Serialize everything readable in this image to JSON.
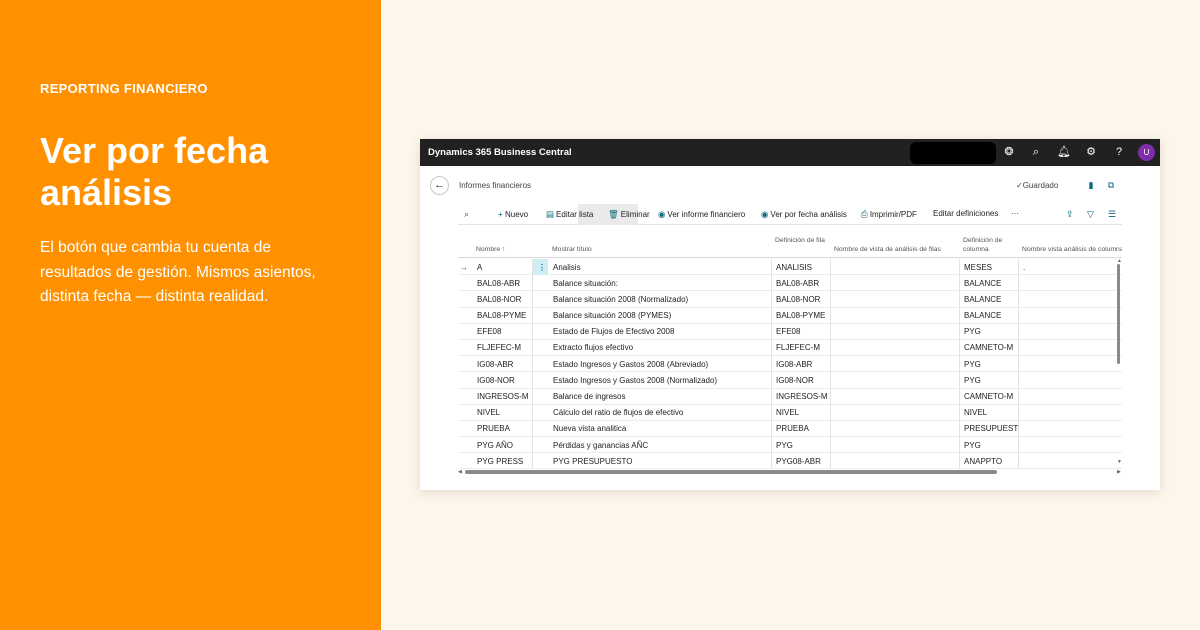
{
  "left_panel": {
    "eyebrow": "REPORTING FINANCIERO",
    "headline": "Ver por fecha análisis",
    "body": "El botón que cambia tu cuenta de resultados de gestión. Mismos asientos, distinta fecha — distinta realidad."
  },
  "app": {
    "title": "Dynamics 365 Business Central",
    "avatar_initial": "U",
    "topbar_icons": [
      "copilot-icon",
      "search-icon",
      "bell-icon",
      "gear-icon",
      "help-icon"
    ]
  },
  "page": {
    "breadcrumb": "Informes financieros",
    "saved_label": "Guardado"
  },
  "actions": {
    "nuevo": "Nuevo",
    "editar_lista": "Editar lista",
    "eliminar": "Eliminar",
    "ver_informe": "Ver informe financiero",
    "ver_fecha": "Ver por fecha análisis",
    "imprimir": "Imprimir/PDF",
    "editar_definiciones": "Editar definiciones",
    "more": "···"
  },
  "table": {
    "headers": {
      "nombre": "Nombre ↑",
      "titulo": "Mostrar título",
      "def_fila": "Definición de fila",
      "vista_filas": "Nombre de vista de análisis de filas",
      "def_columna": "Definición de columna",
      "vista_columnas": "Nombre vista análisis de columnas"
    },
    "rows": [
      {
        "nombre": "A",
        "titulo": "Analisis",
        "fila": "ANALISIS",
        "columna": "MESES",
        "vista_col": "."
      },
      {
        "nombre": "BAL08-ABR",
        "titulo": "Balance situación:",
        "fila": "BAL08-ABR",
        "columna": "BALANCE",
        "vista_col": ""
      },
      {
        "nombre": "BAL08-NOR",
        "titulo": "Balance situación 2008 (Normalizado)",
        "fila": "BAL08-NOR",
        "columna": "BALANCE",
        "vista_col": ""
      },
      {
        "nombre": "BAL08-PYME",
        "titulo": "Balance situación 2008 (PYMES)",
        "fila": "BAL08-PYME",
        "columna": "BALANCE",
        "vista_col": ""
      },
      {
        "nombre": "EFE08",
        "titulo": "Estado de Flujos de Efectivo 2008",
        "fila": "EFE08",
        "columna": "PYG",
        "vista_col": ""
      },
      {
        "nombre": "FLJEFEC-M",
        "titulo": "Extracto flujos efectivo",
        "fila": "FLJEFEC-M",
        "columna": "CAMNETO-M",
        "vista_col": ""
      },
      {
        "nombre": "IG08-ABR",
        "titulo": "Estado Ingresos y Gastos 2008 (Abreviado)",
        "fila": "IG08-ABR",
        "columna": "PYG",
        "vista_col": ""
      },
      {
        "nombre": "IG08-NOR",
        "titulo": "Estado Ingresos y Gastos 2008 (Normalizado)",
        "fila": "IG08-NOR",
        "columna": "PYG",
        "vista_col": ""
      },
      {
        "nombre": "INGRESOS-M",
        "titulo": "Balance de ingresos",
        "fila": "INGRESOS-M",
        "columna": "CAMNETO-M",
        "vista_col": ""
      },
      {
        "nombre": "NIVEL",
        "titulo": "Cálculo del ratio de flujos de efectivo",
        "fila": "NIVEL",
        "columna": "NIVEL",
        "vista_col": ""
      },
      {
        "nombre": "PRUEBA",
        "titulo": "Nueva vista analitica",
        "fila": "PRUEBA",
        "columna": "PRESUPUEST",
        "vista_col": ""
      },
      {
        "nombre": "PYG AÑO",
        "titulo": "Pérdidas y ganancias  AÑC",
        "fila": "PYG",
        "columna": "PYG",
        "vista_col": ""
      },
      {
        "nombre": "PYG PRESS",
        "titulo": "PYG PRESUPUESTO",
        "fila": "PYG08-ABR",
        "columna": "ANAPPTO",
        "vista_col": ""
      }
    ]
  },
  "colors": {
    "accent_orange": "#ff9100",
    "page_bg": "#fdf6ea",
    "topbar": "#212121",
    "teal_icon": "#0a6b7b",
    "avatar": "#7c2fa8"
  }
}
